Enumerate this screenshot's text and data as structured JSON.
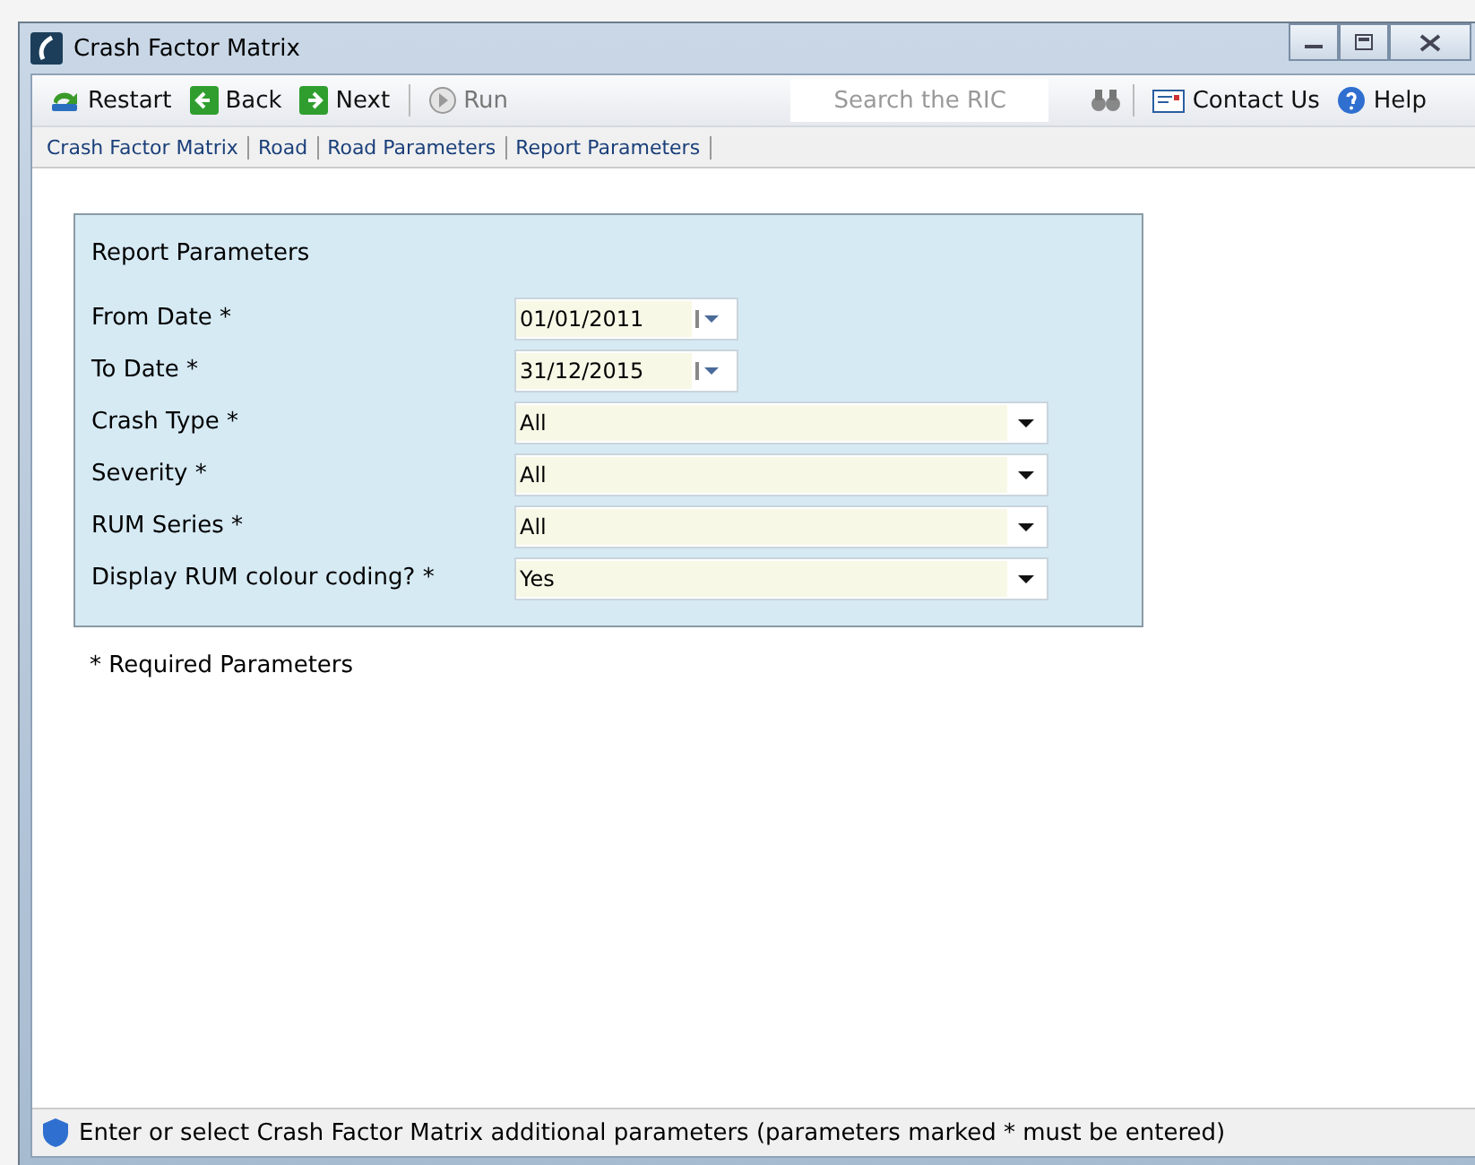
{
  "window": {
    "title": "Crash Factor Matrix"
  },
  "toolbar": {
    "buttons": [
      {
        "kind": "restart",
        "label": "Restart",
        "disabled": false
      },
      {
        "kind": "back",
        "label": "Back",
        "disabled": false
      },
      {
        "kind": "next",
        "label": "Next",
        "disabled": false
      },
      {
        "kind": "run",
        "label": "Run",
        "disabled": true
      }
    ],
    "search": {
      "placeholder": "Search the RIC"
    },
    "links": [
      {
        "kind": "contact",
        "label": "Contact Us"
      },
      {
        "kind": "help",
        "label": "Help"
      }
    ]
  },
  "breadcrumb": [
    "Crash Factor Matrix",
    "Road",
    "Road Parameters",
    "Report Parameters"
  ],
  "panel": {
    "title": "Report Parameters",
    "fields": [
      {
        "kind": "date",
        "label": "From Date *",
        "value": "01/01/2011"
      },
      {
        "kind": "date",
        "label": "To Date *",
        "value": "31/12/2015"
      },
      {
        "kind": "select",
        "label": "Crash Type *",
        "value": "All"
      },
      {
        "kind": "select",
        "label": "Severity *",
        "value": "All"
      },
      {
        "kind": "select",
        "label": "RUM Series *",
        "value": "All"
      },
      {
        "kind": "select",
        "label": "Display RUM colour coding? *",
        "value": "Yes"
      }
    ]
  },
  "note": "* Required Parameters",
  "status_bar": "Enter or select Crash Factor Matrix additional parameters (parameters marked * must be entered)"
}
